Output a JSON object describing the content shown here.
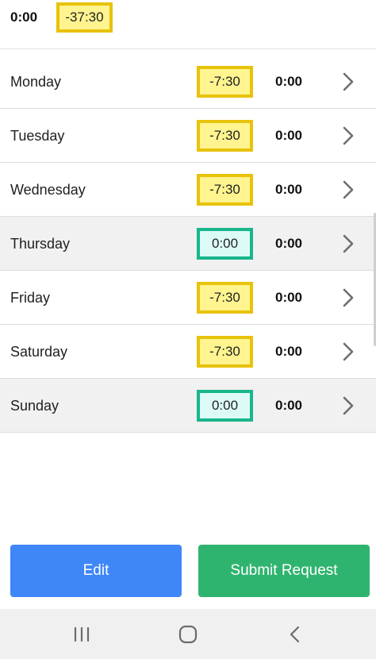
{
  "summary": {
    "total_hours": "0:00",
    "total_diff": "-37:30"
  },
  "days": [
    {
      "name": "Monday",
      "diff": "-7:30",
      "hours": "0:00"
    },
    {
      "name": "Tuesday",
      "diff": "-7:30",
      "hours": "0:00"
    },
    {
      "name": "Wednesday",
      "diff": "-7:30",
      "hours": "0:00"
    },
    {
      "name": "Thursday",
      "diff": "0:00",
      "hours": "0:00"
    },
    {
      "name": "Friday",
      "diff": "-7:30",
      "hours": "0:00"
    },
    {
      "name": "Saturday",
      "diff": "-7:30",
      "hours": "0:00"
    },
    {
      "name": "Sunday",
      "diff": "0:00",
      "hours": "0:00"
    }
  ],
  "actions": {
    "edit_label": "Edit",
    "submit_label": "Submit Request"
  },
  "icons": {
    "row_arrow": "chevron-right-icon",
    "nav_recent": "recent-apps-icon",
    "nav_home": "home-icon",
    "nav_back": "back-icon"
  },
  "colors": {
    "deficit_badge_border": "#e8c20b",
    "deficit_badge_fill": "#fff48f",
    "balanced_badge_border": "#18b68c",
    "balanced_badge_fill": "#ddfbf6",
    "edit_button": "#3f86f7",
    "submit_button": "#2fb46f",
    "weekend_holiday_row": "#f1f1f1"
  }
}
